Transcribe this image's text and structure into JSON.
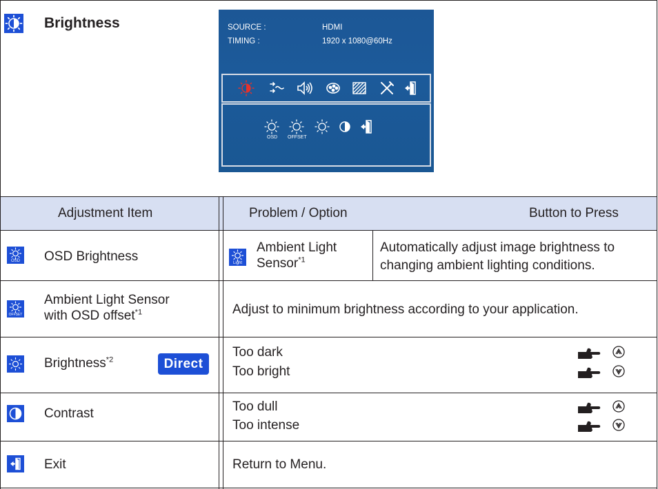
{
  "title": "Brightness",
  "osd": {
    "source_label": "SOURCE :",
    "source_value": "HDMI",
    "timing_label": "TIMING :",
    "timing_value": "1920 x 1080@60Hz",
    "icon_osd_caption": "OSD",
    "icon_offset_caption": "OFFSET"
  },
  "table": {
    "headers": {
      "adjustment_item": "Adjustment Item",
      "problem_option": "Problem / Option",
      "button_to_press": "Button to Press"
    },
    "rows": [
      {
        "item": "OSD Brightness",
        "icon_caption": "OSD",
        "option_label": "Ambient Light Sensor",
        "option_sup": "1",
        "option_icon_caption": "Light",
        "description_line1": "Automatically adjust image brightness to",
        "description_line2": "changing ambient lighting conditions."
      },
      {
        "item_line1": "Ambient Light Sensor",
        "item_line2": "with OSD offset",
        "item_sup": "1",
        "icon_caption": "OFFSET",
        "description": "Adjust to minimum brightness according to your application."
      },
      {
        "item": "Brightness",
        "item_sup": "2",
        "badge": "Direct",
        "option1": "Too dark",
        "option2": "Too bright"
      },
      {
        "item": "Contrast",
        "option1": "Too dull",
        "option2": "Too intense"
      },
      {
        "item": "Exit",
        "description": "Return to Menu."
      }
    ]
  }
}
